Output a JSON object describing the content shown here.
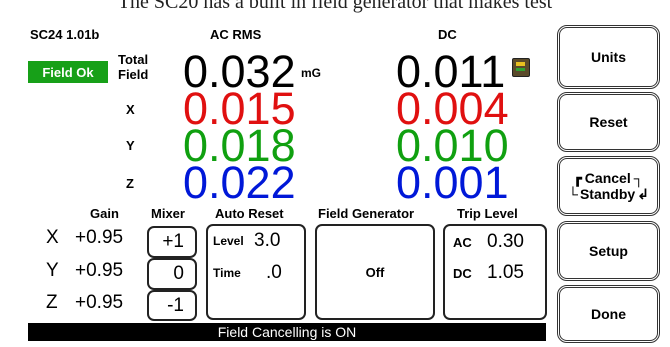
{
  "caption": "The SC20 has a built in field generator that makes test",
  "header": {
    "model": "SC24 1.01b",
    "ac_label": "AC RMS",
    "dc_label": "DC",
    "status_badge": "Field Ok",
    "total_label_line1": "Total",
    "total_label_line2": "Field"
  },
  "readings": {
    "unit": "mG",
    "total": {
      "ac": "0.032",
      "dc": "0.011"
    },
    "x": {
      "label": "X",
      "ac": "0.015",
      "dc": "0.004",
      "color": "#e01010"
    },
    "y": {
      "label": "Y",
      "ac": "0.018",
      "dc": "0.010",
      "color": "#10a010"
    },
    "z": {
      "label": "Z",
      "ac": "0.022",
      "dc": "0.001",
      "color": "#0018d8"
    }
  },
  "controls": {
    "gain_label": "Gain",
    "mixer_label": "Mixer",
    "auto_reset_label": "Auto Reset",
    "field_generator_label": "Field Generator",
    "trip_level_label": "Trip Level",
    "rows": [
      {
        "axis": "X",
        "gain": "+0.95",
        "mixer": "+1"
      },
      {
        "axis": "Y",
        "gain": "+0.95",
        "mixer": "0"
      },
      {
        "axis": "Z",
        "gain": "+0.95",
        "mixer": "-1"
      }
    ],
    "auto_reset": {
      "level_label": "Level",
      "level_value": "3.0",
      "time_label": "Time",
      "time_value": ".0"
    },
    "field_generator_state": "Off",
    "trip_level": {
      "ac_label": "AC",
      "ac_value": "0.30",
      "dc_label": "DC",
      "dc_value": "1.05"
    }
  },
  "status_bar": "Field Cancelling is ON",
  "buttons": {
    "units": "Units",
    "reset": "Reset",
    "cancel_standby_line1": "Cancel",
    "cancel_standby_line2": "Standby",
    "setup": "Setup",
    "done": "Done"
  },
  "icons": {
    "battery": "battery-icon"
  }
}
